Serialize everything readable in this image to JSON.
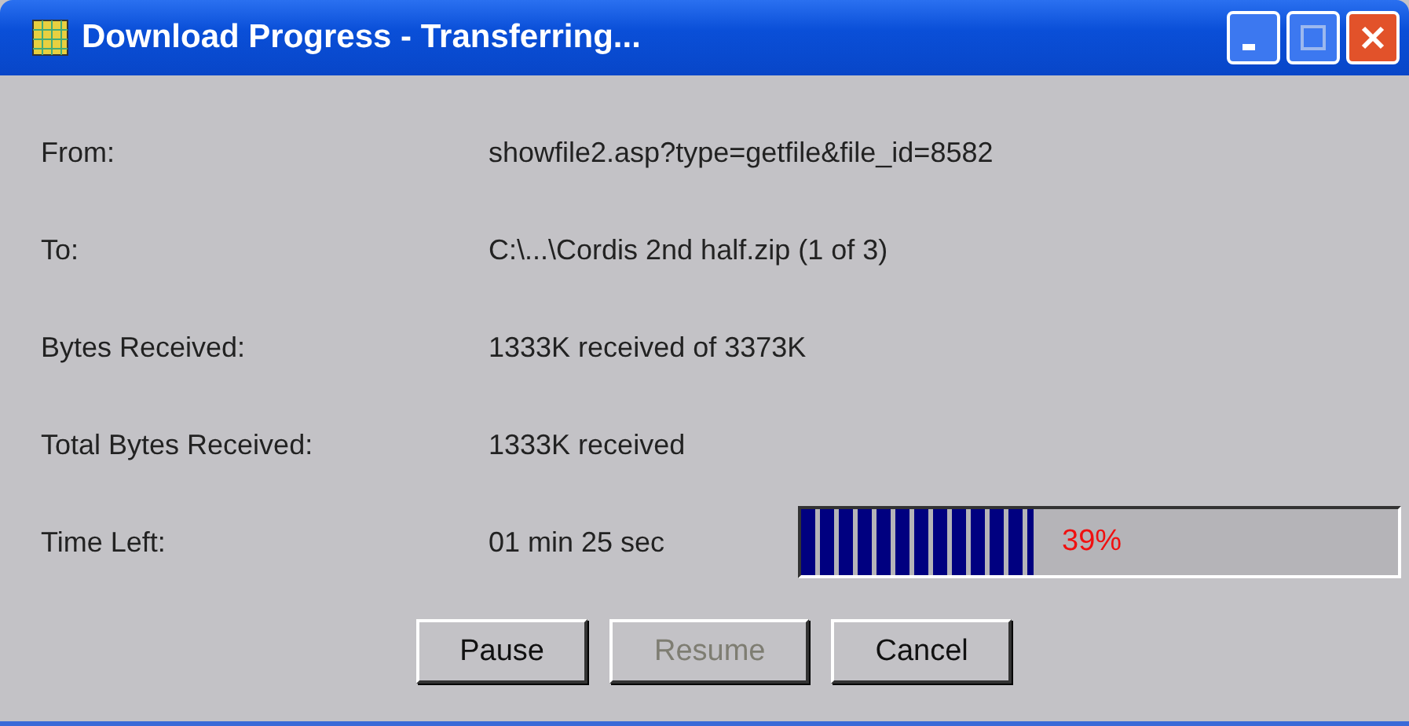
{
  "window": {
    "title": "Download Progress - Transferring..."
  },
  "fields": [
    {
      "label": "From:",
      "value": "showfile2.asp?type=getfile&file_id=8582"
    },
    {
      "label": "To:",
      "value": "C:\\...\\Cordis 2nd half.zip (1 of 3)"
    },
    {
      "label": "Bytes Received:",
      "value": "1333K received of 3373K"
    },
    {
      "label": "Total Bytes Received:",
      "value": "1333K received"
    },
    {
      "label": "Time Left:",
      "value": "01 min 25 sec"
    }
  ],
  "progress": {
    "level": 0.39,
    "reading": "39%"
  },
  "buttons": [
    {
      "label": "Pause",
      "disabled": false
    },
    {
      "label": "Resume",
      "disabled": true
    },
    {
      "label": "Cancel",
      "disabled": false
    }
  ]
}
